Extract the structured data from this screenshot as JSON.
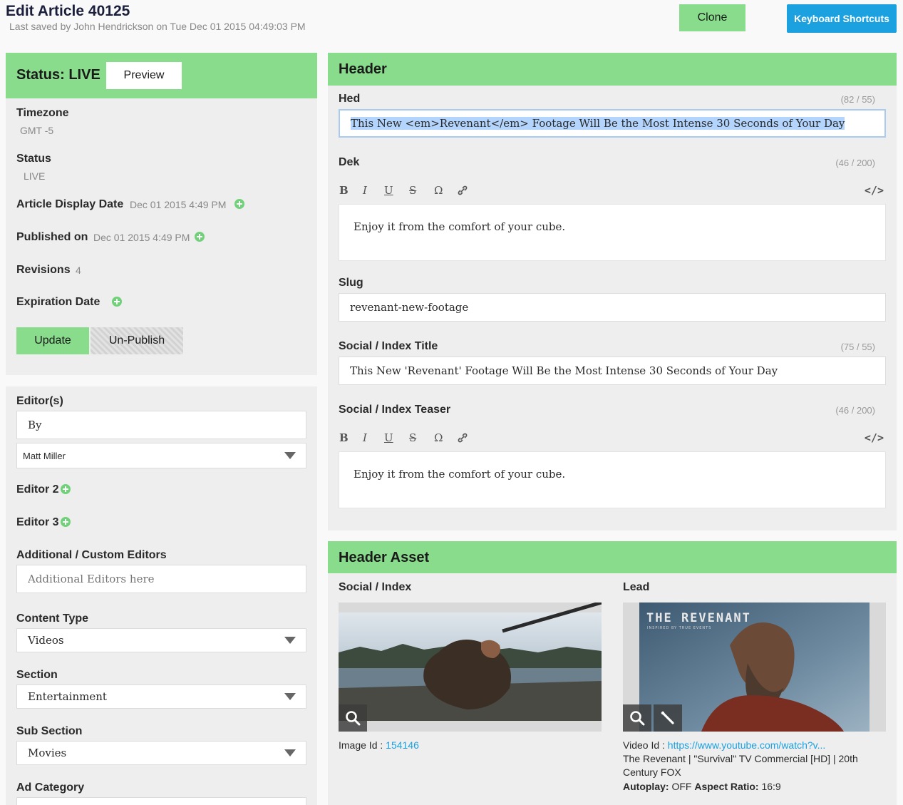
{
  "page": {
    "title": "Edit Article 40125",
    "last_saved": "Last saved by John Hendrickson on Tue Dec 01 2015 04:49:03 PM",
    "clone_label": "Clone",
    "shortcuts_label": "Keyboard Shortcuts"
  },
  "status_panel": {
    "heading": "Status: LIVE",
    "preview_label": "Preview",
    "timezone_label": "Timezone",
    "timezone_value": "GMT -5",
    "status_label": "Status",
    "status_value": "LIVE",
    "display_date_label": "Article Display Date",
    "display_date_value": "Dec 01 2015 4:49 PM",
    "published_label": "Published on",
    "published_value": "Dec 01 2015 4:49 PM",
    "revisions_label": "Revisions",
    "revisions_value": "4",
    "expiration_label": "Expiration Date",
    "update_label": "Update",
    "unpublish_label": "Un-Publish"
  },
  "meta_panel": {
    "editors_label": "Editor(s)",
    "by_value": "By",
    "editor_select": "Matt Miller",
    "editor2_label": "Editor 2",
    "editor3_label": "Editor 3",
    "custom_editors_label": "Additional / Custom Editors",
    "custom_editors_placeholder": "Additional Editors here",
    "content_type_label": "Content Type",
    "content_type_value": "Videos",
    "section_label": "Section",
    "section_value": "Entertainment",
    "subsection_label": "Sub Section",
    "subsection_value": "Movies",
    "ad_category_label": "Ad Category"
  },
  "header_panel": {
    "heading": "Header",
    "hed_label": "Hed",
    "hed_counter": "(82 / 55)",
    "hed_value": "This New <em>Revenant</em> Footage Will Be the Most Intense 30 Seconds of Your Day",
    "dek_label": "Dek",
    "dek_counter": "(46 / 200)",
    "dek_value": "Enjoy it from the comfort of your cube.",
    "slug_label": "Slug",
    "slug_value": "revenant-new-footage",
    "social_title_label": "Social / Index Title",
    "social_title_counter": "(75 / 55)",
    "social_title_value": "This New 'Revenant' Footage Will Be the Most Intense 30 Seconds of Your Day",
    "social_teaser_label": "Social / Index Teaser",
    "social_teaser_counter": "(46 / 200)",
    "social_teaser_value": "Enjoy it from the comfort of your cube.",
    "toolbar": {
      "bold": "B",
      "italic": "I",
      "underline": "U",
      "strike": "S",
      "omega": "Ω",
      "code": "</>"
    }
  },
  "asset_panel": {
    "heading": "Header Asset",
    "social_label": "Social / Index",
    "lead_label": "Lead",
    "image_id_label": "Image Id : ",
    "image_id_value": "154146",
    "video_id_label": "Video Id : ",
    "video_id_value": "https://www.youtube.com/watch?v...",
    "video_title": "The Revenant | \"Survival\" TV Commercial [HD] | 20th Century FOX",
    "autoplay_label": "Autoplay:",
    "autoplay_value": "OFF",
    "aspect_label": "Aspect Ratio:",
    "aspect_value": "16:9",
    "poster_title": "THE REVENANT",
    "poster_tagline": "INSPIRED BY TRUE EVENTS"
  },
  "colors": {
    "accent_green": "#88dc8c",
    "plus_green": "#6fd279",
    "link_blue": "#1ba0e0",
    "panel_gray": "#eeeeee"
  },
  "icons": [
    "plus-icon",
    "caret-down-icon",
    "link-icon",
    "code-icon",
    "search-icon",
    "edit-icon"
  ]
}
